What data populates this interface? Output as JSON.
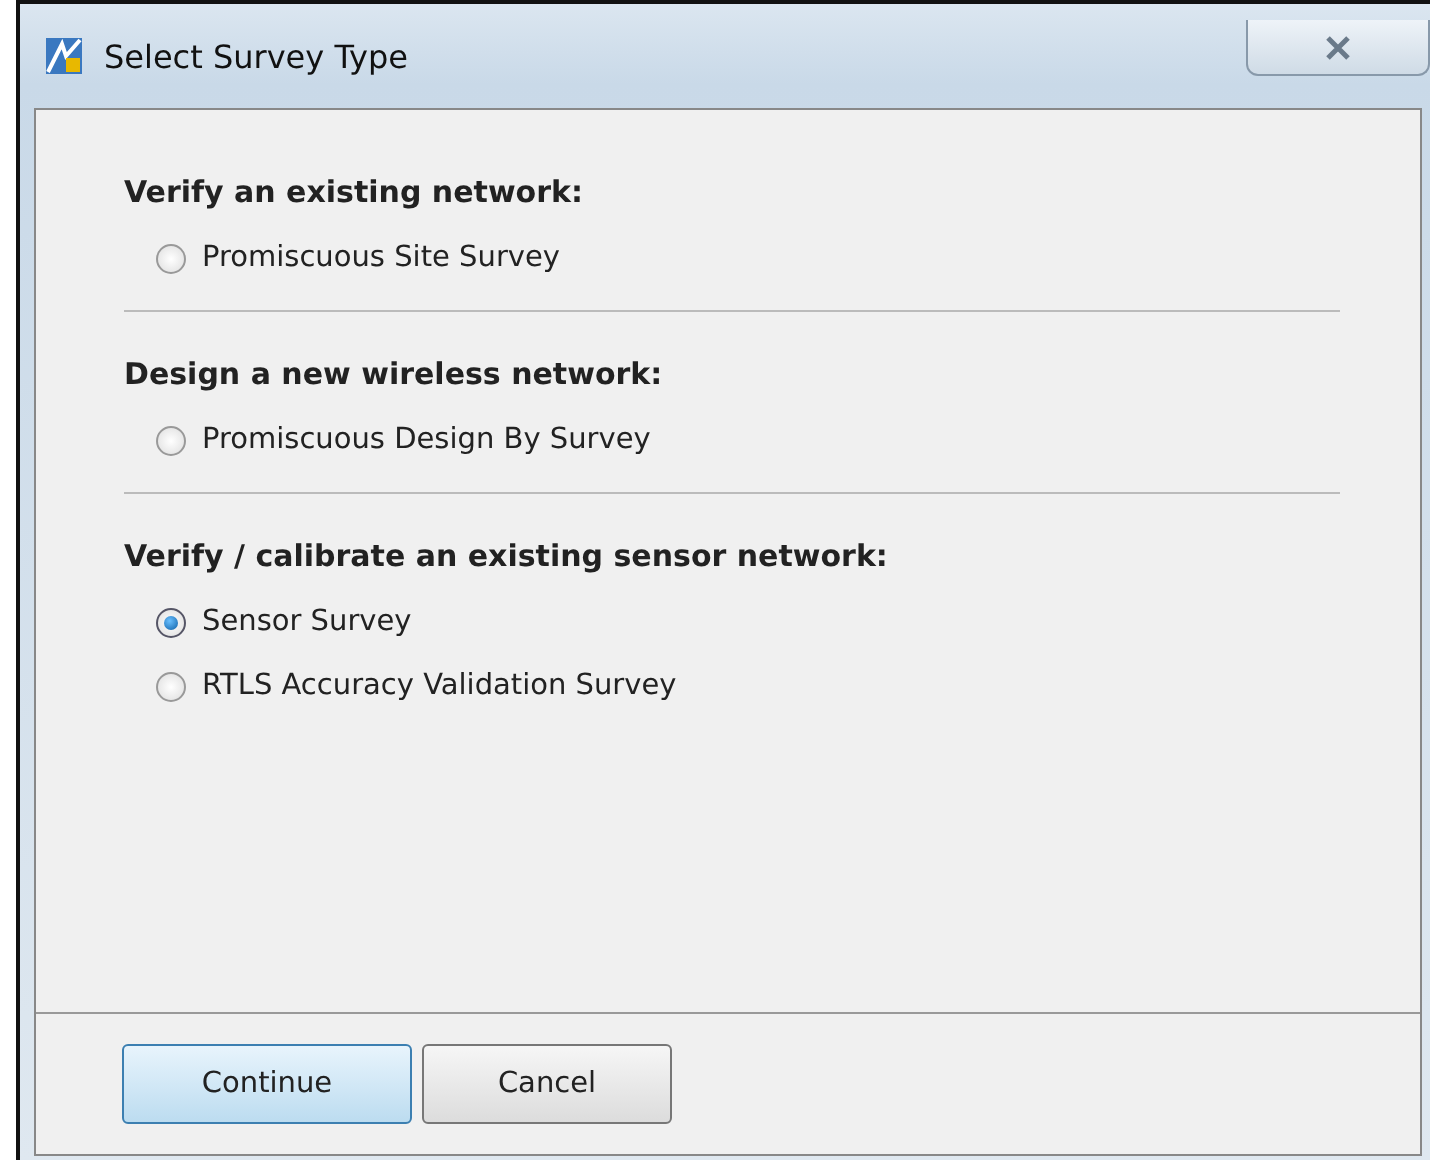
{
  "window": {
    "title": "Select Survey Type"
  },
  "groups": [
    {
      "heading": "Verify an existing network:",
      "options": [
        {
          "label": "Promiscuous Site Survey",
          "selected": false
        }
      ]
    },
    {
      "heading": "Design a new wireless network:",
      "options": [
        {
          "label": "Promiscuous Design By Survey",
          "selected": false
        }
      ]
    },
    {
      "heading": "Verify / calibrate an existing sensor network:",
      "options": [
        {
          "label": "Sensor Survey",
          "selected": true
        },
        {
          "label": "RTLS Accuracy Validation Survey",
          "selected": false
        }
      ]
    }
  ],
  "buttons": [
    {
      "label": "Continue",
      "default": true
    },
    {
      "label": "Cancel",
      "default": false
    }
  ]
}
